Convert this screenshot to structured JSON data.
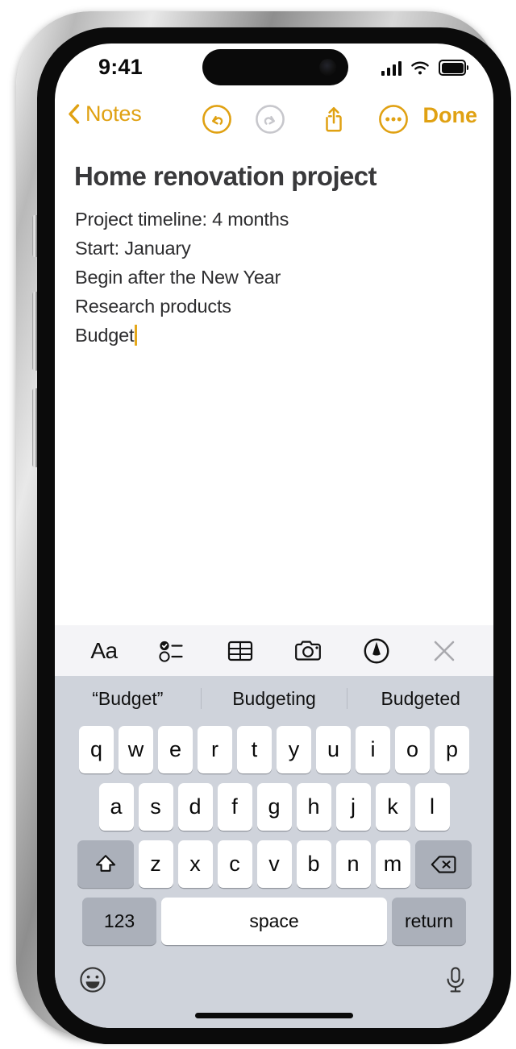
{
  "status_bar": {
    "time": "9:41",
    "cellular_icon": "signal-bars-icon",
    "wifi_icon": "wifi-icon",
    "battery_icon": "battery-full-icon"
  },
  "nav_bar": {
    "back_label": "Notes",
    "back_icon": "chevron-left-icon",
    "undo_icon": "undo-icon",
    "redo_icon": "redo-icon",
    "share_icon": "share-icon",
    "more_icon": "ellipsis-circle-icon",
    "done_label": "Done",
    "accent_color": "#E0A112",
    "disabled_color": "#C7C7CC"
  },
  "note": {
    "title": "Home renovation project",
    "lines": [
      "Project timeline: 4 months",
      "Start: January",
      "Begin after the New Year",
      "Research products",
      "Budget"
    ],
    "caret_after_line_index": 4,
    "caret_color": "#E5A81B"
  },
  "format_toolbar": {
    "items": [
      {
        "name": "text-format-icon",
        "label": "Aa"
      },
      {
        "name": "checklist-icon",
        "label": ""
      },
      {
        "name": "table-icon",
        "label": ""
      },
      {
        "name": "camera-icon",
        "label": ""
      },
      {
        "name": "markup-pen-icon",
        "label": ""
      },
      {
        "name": "close-icon",
        "label": ""
      }
    ],
    "background_color": "#F4F4F7"
  },
  "keyboard": {
    "predictions": [
      "“Budget”",
      "Budgeting",
      "Budgeted"
    ],
    "row1": [
      "q",
      "w",
      "e",
      "r",
      "t",
      "y",
      "u",
      "i",
      "o",
      "p"
    ],
    "row2": [
      "a",
      "s",
      "d",
      "f",
      "g",
      "h",
      "j",
      "k",
      "l"
    ],
    "row3": [
      "z",
      "x",
      "c",
      "v",
      "b",
      "n",
      "m"
    ],
    "shift_icon": "shift-icon",
    "backspace_icon": "backspace-icon",
    "numbers_label": "123",
    "space_label": "space",
    "return_label": "return",
    "emoji_icon": "emoji-smiley-icon",
    "dictation_icon": "microphone-icon",
    "background_color": "#CFD3DB",
    "key_color": "#FFFFFF",
    "modifier_key_color": "#ABB0BA"
  }
}
